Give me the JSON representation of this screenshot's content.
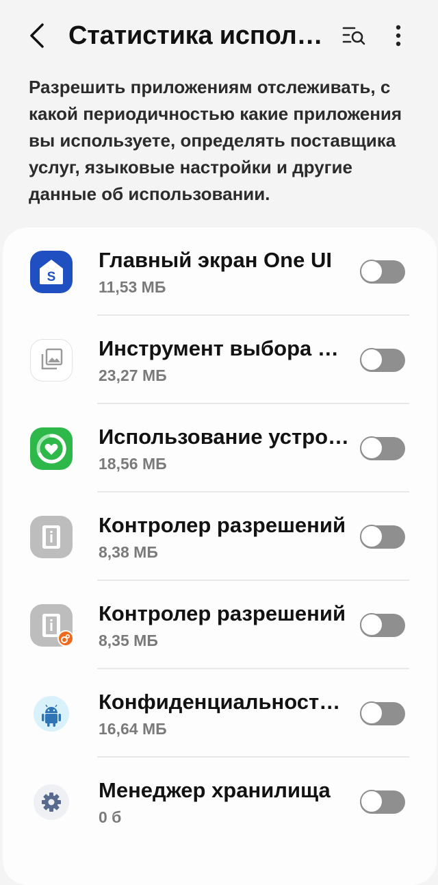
{
  "header": {
    "title": "Статистика испол…"
  },
  "description": "Разрешить приложениям отслеживать, с какой периодичностью какие приложения вы используете, определять поставщика услуг, языковые настройки и другие данные об использовании.",
  "apps": [
    {
      "name": "Главный экран One UI",
      "size": "11,53 МБ",
      "icon": "one-ui-home-icon",
      "enabled": false
    },
    {
      "name": "Инструмент выбора м…",
      "size": "23,27 МБ",
      "icon": "media-picker-icon",
      "enabled": false
    },
    {
      "name": "Использование устрой…",
      "size": "18,56 МБ",
      "icon": "device-care-icon",
      "enabled": false
    },
    {
      "name": "Контролер разрешений",
      "size": "8,38 МБ",
      "icon": "permission-controller-icon",
      "enabled": false
    },
    {
      "name": "Контролер разрешений",
      "size": "8,35 МБ",
      "icon": "permission-controller-badged-icon",
      "enabled": false
    },
    {
      "name": "Конфиденциальность…",
      "size": "16,64 МБ",
      "icon": "android-privacy-icon",
      "enabled": false
    },
    {
      "name": "Менеджер хранилища",
      "size": "0 б",
      "icon": "storage-manager-gear-icon",
      "enabled": false
    }
  ],
  "colors": {
    "background": "#f4f4f4",
    "card": "#fdfdfd",
    "toggle_off": "#8f8f8f",
    "one_ui_blue": "#1f4fc0",
    "device_care_green": "#2fb84a",
    "badge_orange": "#f06a1d"
  }
}
